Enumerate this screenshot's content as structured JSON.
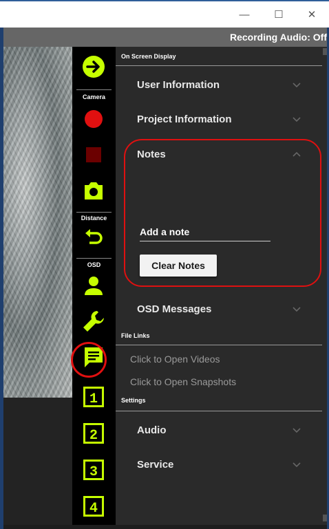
{
  "window": {
    "minimize": "—",
    "maximize": "☐",
    "close": "✕"
  },
  "status": {
    "recording": "Recording Audio: Off"
  },
  "toolbar": {
    "camera_label": "Camera",
    "distance_label": "Distance",
    "osd_label": "OSD",
    "preset_1": "1",
    "preset_2": "2",
    "preset_3": "3",
    "preset_4": "4",
    "icons": [
      "arrow-right-icon",
      "record-icon",
      "stop-icon",
      "camera-icon",
      "undo-icon",
      "user-icon",
      "wrench-icon",
      "notes-icon"
    ],
    "accent": "#c6ff00",
    "record_color": "#e01010",
    "stop_color": "#6b0000"
  },
  "panel": {
    "osd_header": "On Screen Display",
    "user_info": "User Information",
    "project_info": "Project Information",
    "notes": "Notes",
    "note_placeholder": "Add a note",
    "clear_notes": "Clear Notes",
    "osd_messages": "OSD Messages",
    "file_links_header": "File Links",
    "open_videos": "Click to Open Videos",
    "open_snapshots": "Click to Open Snapshots",
    "settings_header": "Settings",
    "audio": "Audio",
    "service": "Service"
  }
}
